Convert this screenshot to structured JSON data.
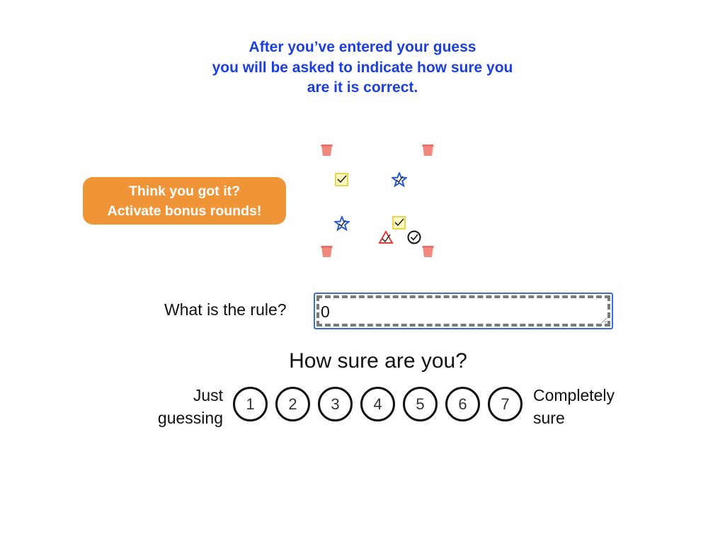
{
  "instruction": {
    "line1": "After you’ve entered your guess",
    "line2": "you will be asked to indicate how sure you",
    "line3": "are it is correct.",
    "color": "#1c3fe0"
  },
  "bonus_button": {
    "line1": "Think you got it?",
    "line2": "Activate bonus rounds!",
    "color": "#ef9437"
  },
  "arena": {
    "tokens": [
      {
        "icon": "bucket-icon",
        "color": "#f08a80"
      },
      {
        "icon": "bucket-icon",
        "color": "#f08a80"
      },
      {
        "icon": "yellow-check-square-icon",
        "color": "#e8d64a"
      },
      {
        "icon": "blue-star-icon",
        "color": "#2a5cc8"
      },
      {
        "icon": "blue-star-icon",
        "color": "#2a5cc8"
      },
      {
        "icon": "yellow-check-square-icon",
        "color": "#e8d64a"
      },
      {
        "icon": "red-triangle-icon",
        "color": "#d9403a"
      },
      {
        "icon": "black-check-circle-icon",
        "color": "#111111"
      },
      {
        "icon": "bucket-icon",
        "color": "#f08a80"
      },
      {
        "icon": "bucket-icon",
        "color": "#f08a80"
      }
    ]
  },
  "rule": {
    "label": "What is the rule?",
    "value": "0"
  },
  "confidence": {
    "title": "How sure are you?",
    "low_label_line1": "Just",
    "low_label_line2": "guessing",
    "high_label_line1": "Completely",
    "high_label_line2": "sure",
    "options": [
      "1",
      "2",
      "3",
      "4",
      "5",
      "6",
      "7"
    ]
  }
}
